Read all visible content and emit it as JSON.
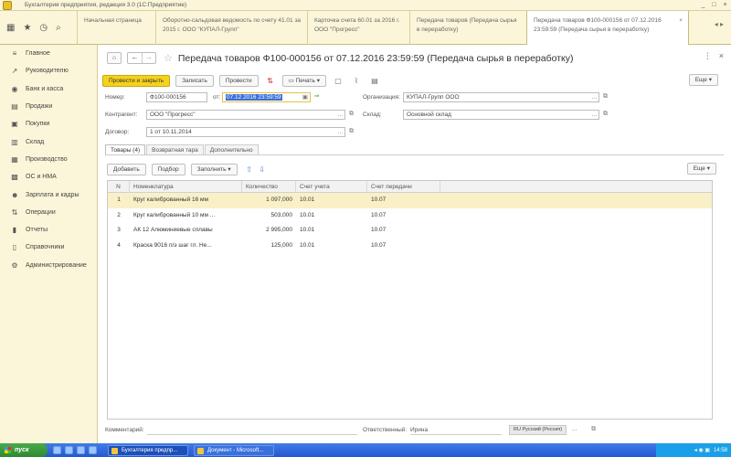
{
  "window": {
    "title": "Бухгалтерия предприятия, редакция 3.0 (1С:Предприятие)",
    "controls": [
      "_",
      "□",
      "×"
    ]
  },
  "left_icons": [
    "grid-icon",
    "star-icon",
    "history-icon",
    "search-icon"
  ],
  "tabs": [
    {
      "label": "Начальная страница",
      "active": false
    },
    {
      "label": "Оборотно-сальдовая ведомость по счету 41.01 за 2015 г. ООО \"КУПАЛ-Групп\"",
      "active": false
    },
    {
      "label": "Карточка счета 60.01 за 2016 г. ООО \"Прогресс\"",
      "active": false
    },
    {
      "label": "Передача товаров (Передача сырья в переработку)",
      "active": false
    },
    {
      "label": "Передача товаров Ф100-000156 от 07.12.2016 23:59:59 (Передача сырья в переработку)",
      "active": true
    }
  ],
  "sidebar": {
    "items": [
      {
        "icon": "menu-icon",
        "label": "Главное"
      },
      {
        "icon": "chart-icon",
        "label": "Руководителю"
      },
      {
        "icon": "bank-icon",
        "label": "Банк и касса"
      },
      {
        "icon": "sales-icon",
        "label": "Продажи"
      },
      {
        "icon": "cart-icon",
        "label": "Покупки"
      },
      {
        "icon": "warehouse-icon",
        "label": "Склад"
      },
      {
        "icon": "factory-icon",
        "label": "Производство"
      },
      {
        "icon": "assets-icon",
        "label": "ОС и НМА"
      },
      {
        "icon": "people-icon",
        "label": "Зарплата и кадры"
      },
      {
        "icon": "operations-icon",
        "label": "Операции"
      },
      {
        "icon": "reports-icon",
        "label": "Отчеты"
      },
      {
        "icon": "books-icon",
        "label": "Справочники"
      },
      {
        "icon": "gear-icon",
        "label": "Администрирование"
      }
    ]
  },
  "doc": {
    "title": "Передача товаров Ф100-000156 от 07.12.2016 23:59:59 (Передача сырья в переработку)"
  },
  "toolbar": {
    "post_close": "Провести и закрыть",
    "save": "Записать",
    "post": "Провести",
    "print": "Печать",
    "more": "Еще"
  },
  "form": {
    "number_label": "Номер:",
    "number": "Ф100-000156",
    "from_label": "от:",
    "date": "07.12.2016 23:59:59",
    "org_label": "Организация:",
    "org": "КУПАЛ-Групп ООО",
    "contractor_label": "Контрагент:",
    "contractor": "ООО \"Прогресс\"",
    "warehouse_label": "Склад:",
    "warehouse": "Основной склад",
    "contract_label": "Договор:",
    "contract": "1 от 10.11.2014"
  },
  "doc_tabs": [
    {
      "label": "Товары (4)",
      "active": true
    },
    {
      "label": "Возвратная тара",
      "active": false
    },
    {
      "label": "Дополнительно",
      "active": false
    }
  ],
  "table_toolbar": {
    "add": "Добавить",
    "pick": "Подбор",
    "fill": "Заполнить",
    "more": "Еще"
  },
  "table": {
    "columns": [
      "N",
      "Номенклатура",
      "Количество",
      "Счет учета",
      "Счет передачи"
    ],
    "rows": [
      {
        "n": "1",
        "nom": "Круг калиброванный 16 мм",
        "qty": "1 097,000",
        "acc": "10.01",
        "trans": "10.07"
      },
      {
        "n": "2",
        "nom": "Круг калиброванный 10 мм ...",
        "qty": "503,000",
        "acc": "10.01",
        "trans": "10.07"
      },
      {
        "n": "3",
        "nom": "АК 12 Алюминиевые сплавы",
        "qty": "2 995,000",
        "acc": "10.01",
        "trans": "10.07"
      },
      {
        "n": "4",
        "nom": "Краска 9016 п/э шаг гл. Не...",
        "qty": "125,000",
        "acc": "10.01",
        "trans": "10.07"
      }
    ]
  },
  "footer": {
    "comment_label": "Комментарий:",
    "responsible_label": "Ответственный:",
    "responsible": "Ирина",
    "lang": "RU Русский (Россия)"
  },
  "taskbar": {
    "start": "пуск",
    "tasks": [
      "Бухгалтерия предпр...",
      "Документ - Microsoft..."
    ],
    "tray_time": "14:58"
  }
}
